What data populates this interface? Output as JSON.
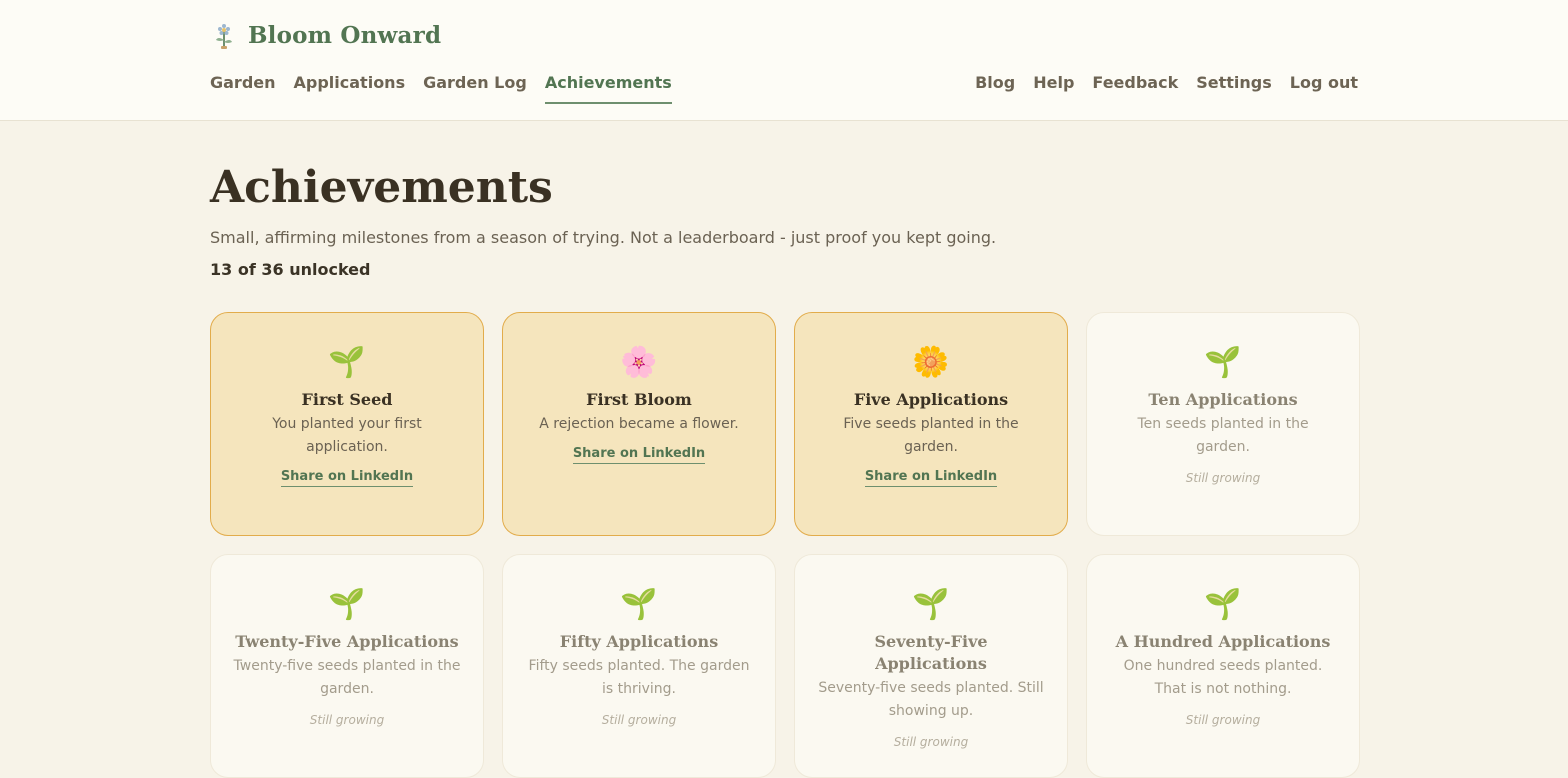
{
  "app": {
    "name": "Bloom Onward",
    "logo_icon": "flower-stem-icon"
  },
  "nav": {
    "left": [
      {
        "label": "Garden"
      },
      {
        "label": "Applications"
      },
      {
        "label": "Garden Log"
      },
      {
        "label": "Achievements",
        "active": true
      }
    ],
    "right": [
      {
        "label": "Blog"
      },
      {
        "label": "Help"
      },
      {
        "label": "Feedback"
      },
      {
        "label": "Settings"
      },
      {
        "label": "Log out"
      }
    ]
  },
  "page": {
    "title": "Achievements",
    "subtitle": "Small, affirming milestones from a season of trying. Not a leaderboard - just proof you kept going.",
    "count": "13 of 36 unlocked"
  },
  "cards": [
    {
      "icon": "🌱",
      "icon_name": "seedling-icon",
      "title": "First Seed",
      "desc": "You planted your first application.",
      "unlocked": true,
      "share_label": "Share on LinkedIn"
    },
    {
      "icon": "🌸",
      "icon_name": "cherry-blossom-icon",
      "title": "First Bloom",
      "desc": "A rejection became a flower.",
      "unlocked": true,
      "share_label": "Share on LinkedIn"
    },
    {
      "icon": "🌼",
      "icon_name": "daisy-icon",
      "title": "Five Applications",
      "desc": "Five seeds planted in the garden.",
      "unlocked": true,
      "share_label": "Share on LinkedIn"
    },
    {
      "icon": "🌱",
      "icon_name": "seedling-icon",
      "title": "Ten Applications",
      "desc": "Ten seeds planted in the garden.",
      "unlocked": false,
      "status": "Still growing"
    },
    {
      "icon": "🌱",
      "icon_name": "seedling-icon",
      "title": "Twenty-Five Applications",
      "desc": "Twenty-five seeds planted in the garden.",
      "unlocked": false,
      "status": "Still growing"
    },
    {
      "icon": "🌱",
      "icon_name": "seedling-icon",
      "title": "Fifty Applications",
      "desc": "Fifty seeds planted. The garden is thriving.",
      "unlocked": false,
      "status": "Still growing"
    },
    {
      "icon": "🌱",
      "icon_name": "seedling-icon",
      "title": "Seventy-Five Applications",
      "desc": "Seventy-five seeds planted. Still showing up.",
      "unlocked": false,
      "status": "Still growing"
    },
    {
      "icon": "🌱",
      "icon_name": "seedling-icon",
      "title": "A Hundred Applications",
      "desc": "One hundred seeds planted. That is not nothing.",
      "unlocked": false,
      "status": "Still growing"
    }
  ],
  "colors": {
    "accent": "#527552",
    "unlocked_bg": "#f5e5bd",
    "unlocked_border": "#e2ac4b",
    "page_bg": "#f7f3e8"
  }
}
